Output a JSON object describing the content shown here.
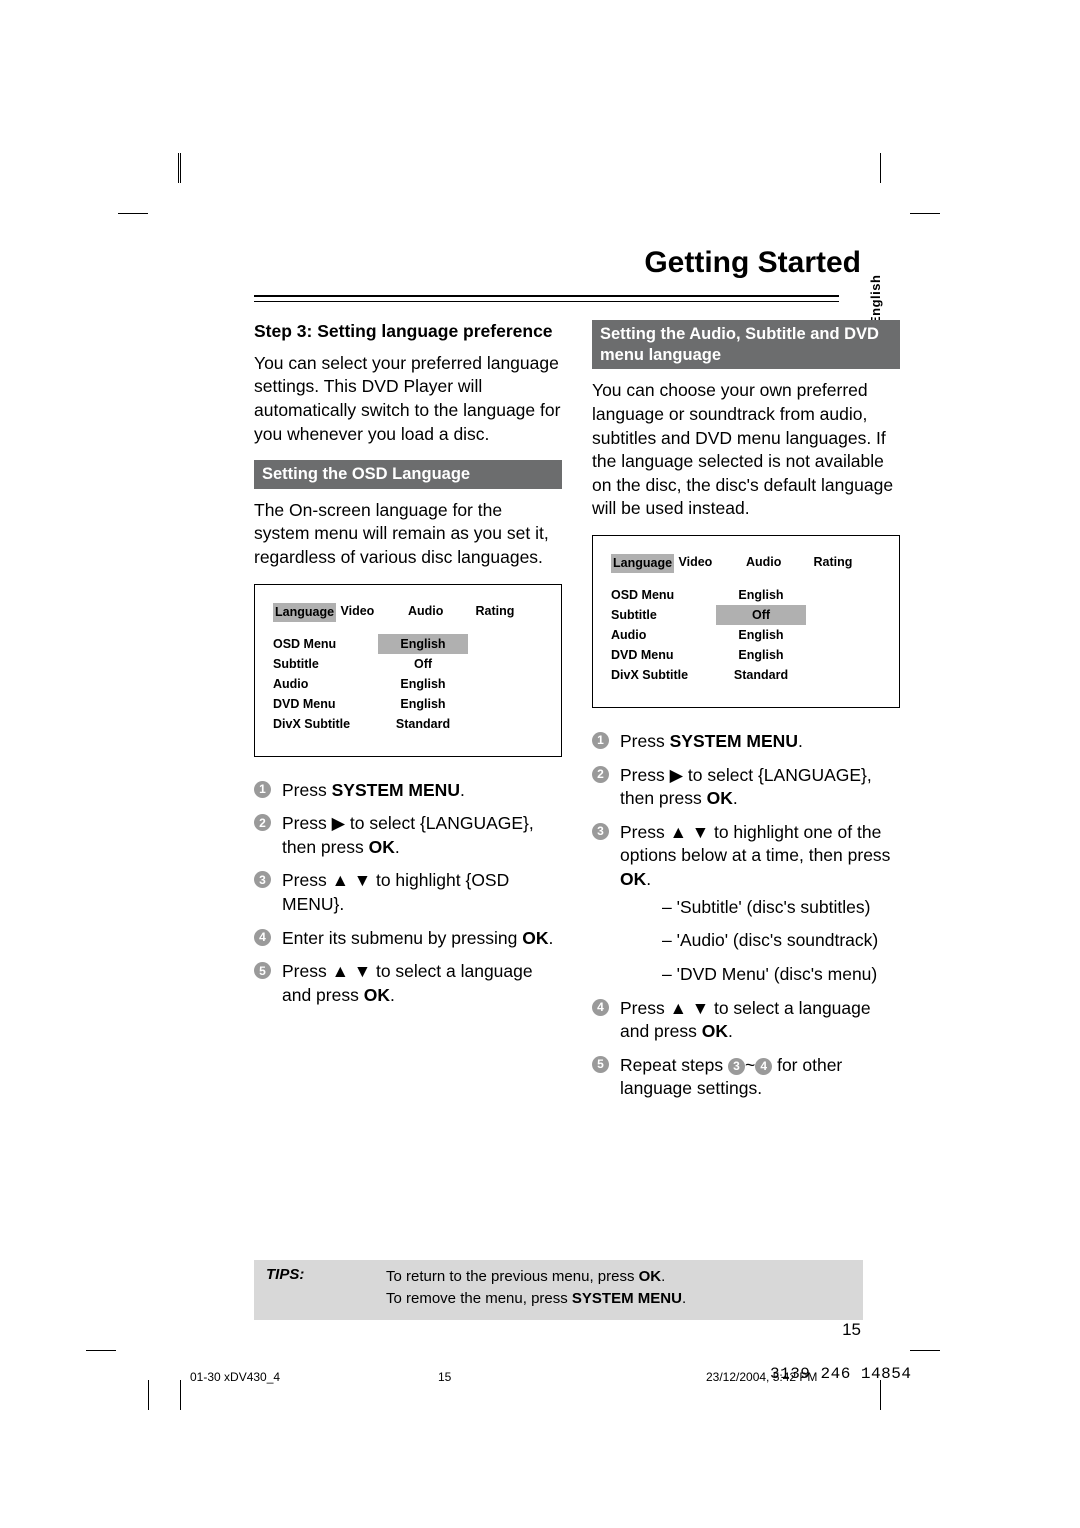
{
  "title": "Getting Started",
  "language_tab": "English",
  "left": {
    "step_head": "Step 3:  Setting language preference",
    "intro": "You can select your preferred language settings. This DVD Player will automatically switch to the language for you whenever you load a disc.",
    "band": "Setting the OSD Language",
    "band_intro": "The On-screen language for the system menu will remain as you set it, regardless of various disc languages.",
    "menu_tabs": [
      "Language",
      "Video",
      "Audio",
      "Rating"
    ],
    "menu_items": [
      {
        "label": "OSD Menu",
        "value": "English",
        "selected": true
      },
      {
        "label": "Subtitle",
        "value": "Off",
        "selected": false
      },
      {
        "label": "Audio",
        "value": "English",
        "selected": false
      },
      {
        "label": "DVD Menu",
        "value": "English",
        "selected": false
      },
      {
        "label": "DivX Subtitle",
        "value": "Standard",
        "selected": false
      }
    ],
    "steps": [
      {
        "n": "1",
        "html": "Press <b>SYSTEM MENU</b>."
      },
      {
        "n": "2",
        "html": "Press ▶ to select {LANGUAGE}, then press <b>OK</b>."
      },
      {
        "n": "3",
        "html": "Press ▲ ▼ to highlight {OSD MENU}."
      },
      {
        "n": "4",
        "html": "Enter its submenu by pressing <b>OK</b>."
      },
      {
        "n": "5",
        "html": "Press ▲ ▼ to select a language and press <b>OK</b>."
      }
    ]
  },
  "right": {
    "band": "Setting the Audio, Subtitle and DVD menu language",
    "intro": "You can choose your own preferred language or soundtrack from audio, subtitles and DVD menu languages. If the language selected is not available on the disc, the disc's default language will be used instead.",
    "menu_tabs": [
      "Language",
      "Video",
      "Audio",
      "Rating"
    ],
    "menu_items": [
      {
        "label": "OSD Menu",
        "value": "English",
        "selected": false
      },
      {
        "label": "Subtitle",
        "value": "Off",
        "selected": true
      },
      {
        "label": "Audio",
        "value": "English",
        "selected": false
      },
      {
        "label": "DVD Menu",
        "value": "English",
        "selected": false
      },
      {
        "label": "DivX Subtitle",
        "value": "Standard",
        "selected": false
      }
    ],
    "steps": [
      {
        "n": "1",
        "html": "Press <b>SYSTEM MENU</b>."
      },
      {
        "n": "2",
        "html": "Press ▶ to select {LANGUAGE}, then press <b>OK</b>."
      },
      {
        "n": "3",
        "html": "Press ▲ ▼ to highlight one of the options below at a time, then press <b>OK</b>.",
        "sub": [
          "'Subtitle' (disc's subtitles)",
          "'Audio' (disc's soundtrack)",
          "'DVD Menu' (disc's menu)"
        ]
      },
      {
        "n": "4",
        "html": "Press ▲ ▼ to select a language and press <b>OK</b>."
      },
      {
        "n": "5",
        "html": "Repeat steps <span class=\"circ-inline\">3</span>~<span class=\"circ-inline\">4</span> for other language settings."
      }
    ]
  },
  "tips": {
    "label": "TIPS:",
    "line1": "To return to the previous menu, press <b>OK</b>.",
    "line2": "To remove the menu, press <b>SYSTEM MENU</b>."
  },
  "page_number": "15",
  "footer": {
    "left": "01-30 xDV430_4",
    "mid": "15",
    "right_ts": "23/12/2004, 5:42 PM",
    "serial": "3139 246 14854"
  }
}
